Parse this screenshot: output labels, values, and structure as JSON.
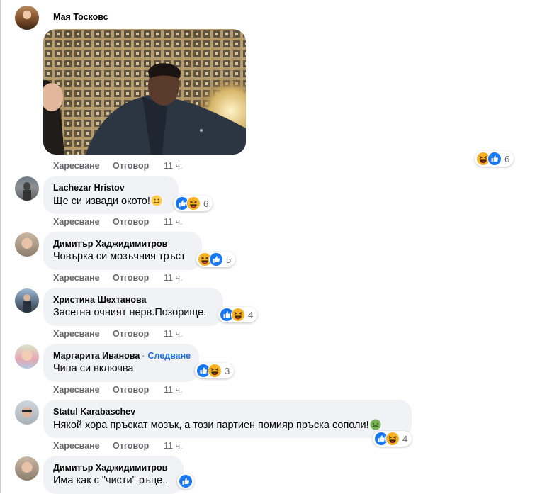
{
  "actions": {
    "like": "Харесване",
    "reply": "Отговор"
  },
  "comments": [
    {
      "author": "Мая Тосковс",
      "text": "",
      "time": "11 ч.",
      "reactions": [
        "haha",
        "like"
      ],
      "reaction_count": "6"
    },
    {
      "author": "Lachezar Hristov",
      "text": "Ще си извади окото!",
      "time": "11 ч.",
      "reactions": [
        "like",
        "haha"
      ],
      "reaction_count": "6"
    },
    {
      "author": "Димитър Хаджидимитров",
      "text": "Човърка си мозъчния тръст",
      "time": "11 ч.",
      "reactions": [
        "haha",
        "like"
      ],
      "reaction_count": "5"
    },
    {
      "author": "Христина Шехтанова",
      "text": "Засегна очният нерв.Позорище.",
      "time": "11 ч.",
      "reactions": [
        "like",
        "haha"
      ],
      "reaction_count": "4"
    },
    {
      "author": "Маргарита Иванова",
      "follow": "Следване",
      "text": "Чипа си включва",
      "time": "11 ч.",
      "reactions": [
        "like",
        "haha"
      ],
      "reaction_count": "3"
    },
    {
      "author": "Statul Karabaschev",
      "text": "Някой хора пръскат мозък, а този партиен помияр пръска сополи!",
      "time": "11 ч.",
      "reactions": [
        "like",
        "haha"
      ],
      "reaction_count": "4"
    },
    {
      "author": "Димитър Хаджидимитров",
      "text": "Има как с \"чисти\" ръце..",
      "time": "",
      "reactions": [
        "like"
      ],
      "reaction_count": ""
    }
  ],
  "colors": {
    "like_blue": "#1877f2",
    "haha_yellow": "#f7b125",
    "bubble": "#f0f2f5",
    "link": "#216fdb"
  },
  "icons": {
    "like": "thumbs-up-icon",
    "haha": "laughing-face-icon",
    "smile": "smiling-face-emoji",
    "nauseated": "nauseated-face-emoji"
  }
}
